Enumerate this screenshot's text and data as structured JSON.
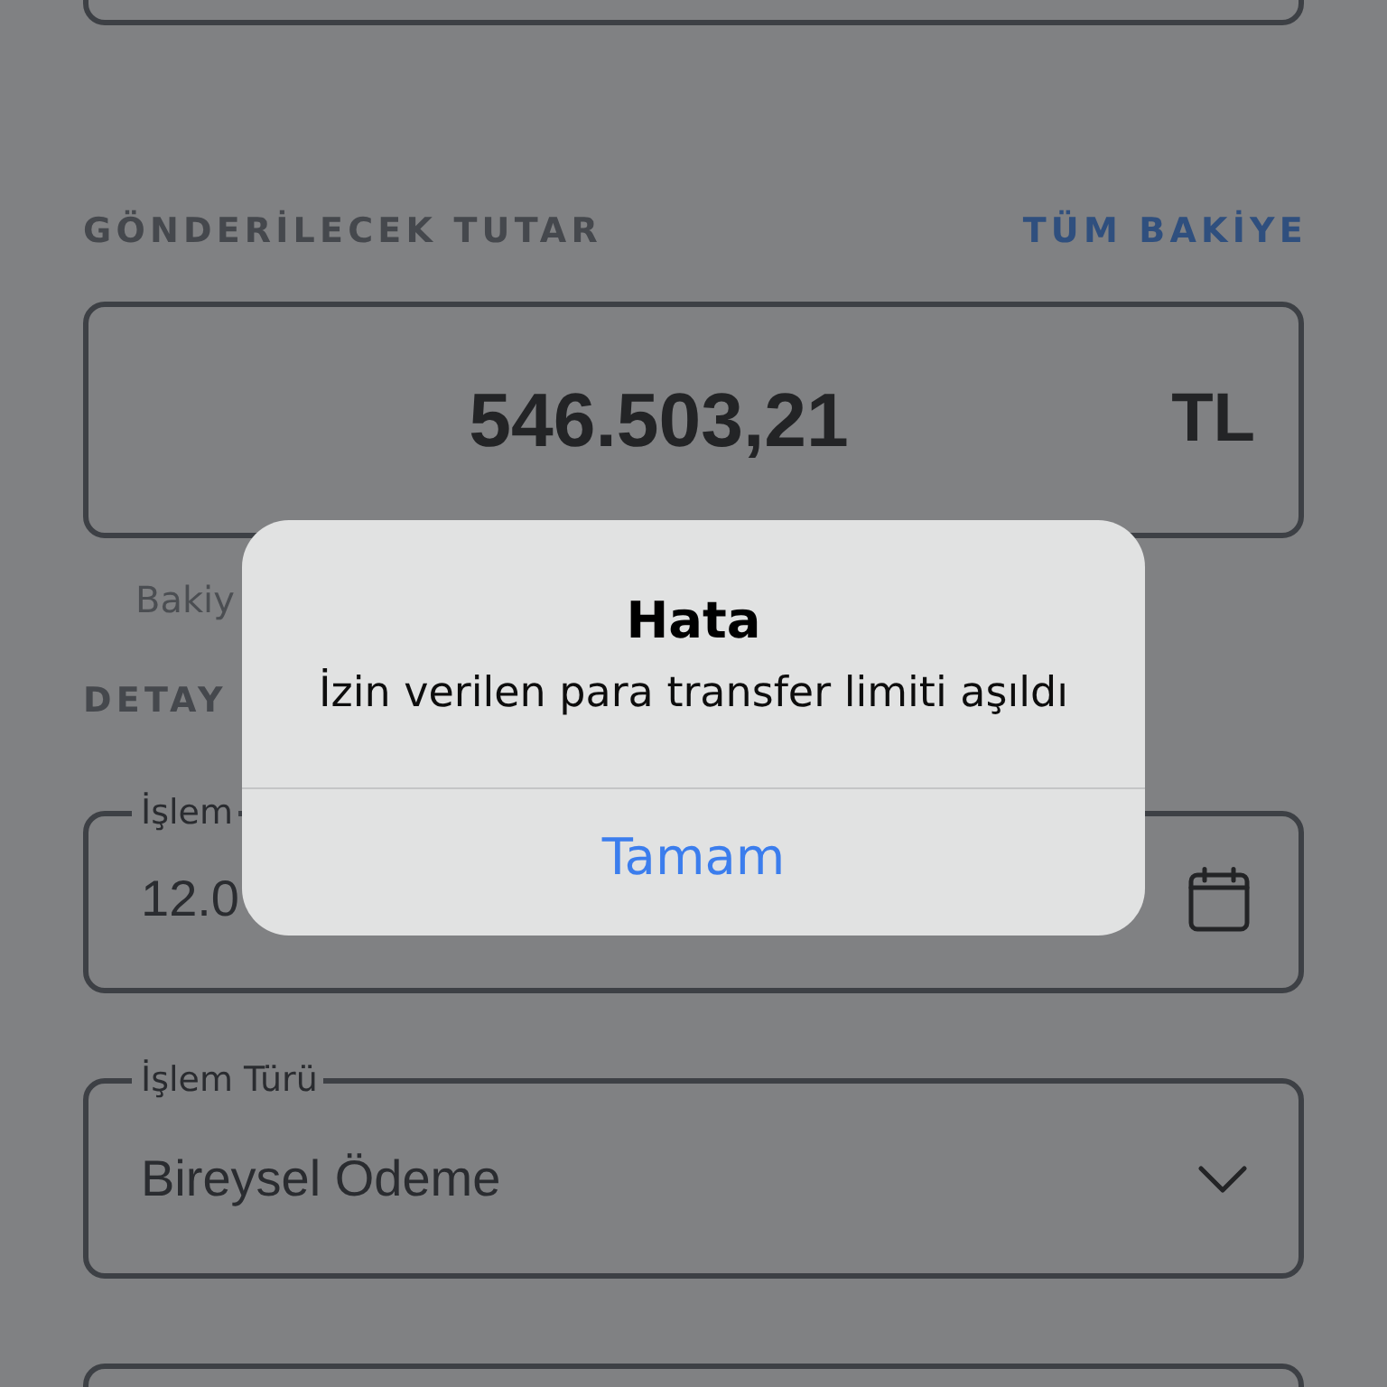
{
  "amount_section": {
    "heading": "GÖNDERİLECEK TUTAR",
    "action": "TÜM BAKİYE",
    "amount": "546.503,21",
    "currency": "TL",
    "note": "Bakiy"
  },
  "details_section": {
    "heading": "DETAY",
    "fields": [
      {
        "kind": "date",
        "label": "İşlem",
        "value": "12.0"
      },
      {
        "kind": "select",
        "label": "İşlem Türü",
        "value": "Bireysel Ödeme"
      }
    ]
  },
  "dialog": {
    "title": "Hata",
    "message": "İzin verilen para transfer limiti aşıldı",
    "buttons": [
      "Tamam"
    ]
  }
}
